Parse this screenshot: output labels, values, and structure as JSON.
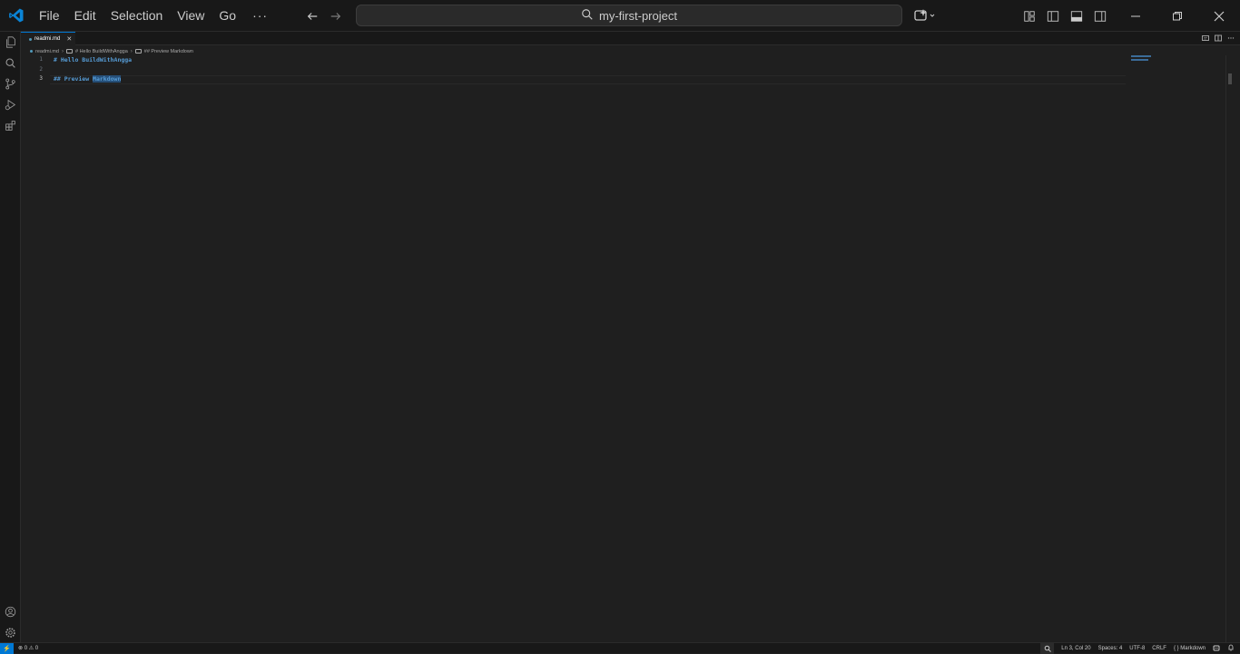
{
  "titlebar": {
    "menu": [
      "File",
      "Edit",
      "Selection",
      "View",
      "Go"
    ],
    "more": "···",
    "search_text": "my-first-project"
  },
  "tab": {
    "label": "readmi.md",
    "close": "✕"
  },
  "breadcrumb": {
    "file": "readmi.md",
    "heading1": "# Hello BuildWithAngga",
    "heading2": "## Preview Markdown"
  },
  "editor": {
    "lines": [
      {
        "number": "1",
        "text": "# Hello BuildWithAngga"
      },
      {
        "number": "2",
        "text": ""
      },
      {
        "number": "3",
        "text_pre": "## Preview ",
        "text_sel": "Markdown"
      }
    ]
  },
  "statusbar": {
    "problems": "⊗ 0 ⚠ 0",
    "position": "Ln 3, Col 20",
    "spaces": "Spaces: 4",
    "encoding": "UTF-8",
    "eol": "CRLF",
    "language": "{ } Markdown"
  },
  "colors": {
    "accent": "#0078d4",
    "heading": "#569cd6",
    "background": "#1f1f1f"
  },
  "icons": [
    "vscode-logo-icon",
    "search-icon",
    "back-arrow-icon",
    "forward-arrow-icon",
    "copilot-icon",
    "explorer-icon",
    "search-view-icon",
    "source-control-icon",
    "run-debug-icon",
    "extensions-icon",
    "account-icon",
    "settings-gear-icon"
  ]
}
